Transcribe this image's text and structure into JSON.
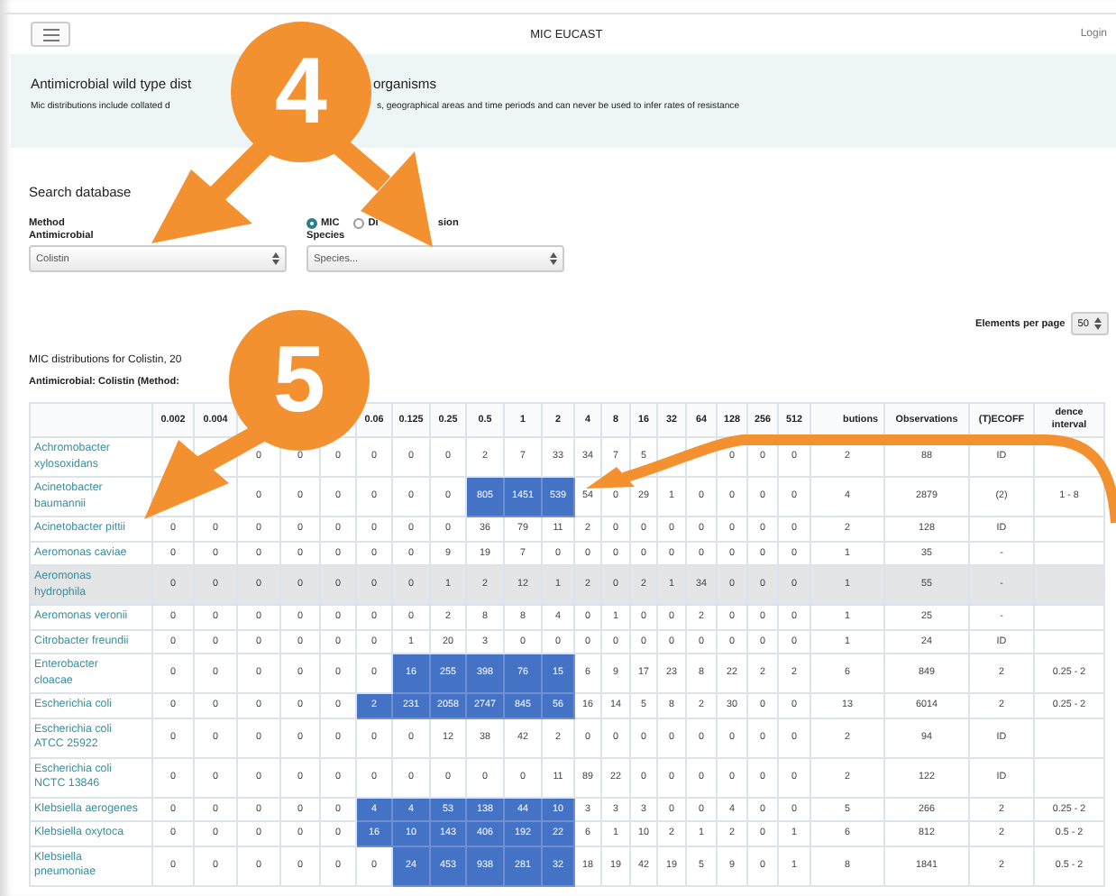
{
  "navbar": {
    "title": "MIC EUCAST",
    "login": "Login"
  },
  "banner": {
    "title_parts": [
      "Antimicrobial wild type dist",
      "organisms"
    ],
    "subtitle_parts": [
      "Mic distributions include collated d",
      "s, geographical areas and time periods and can never be used to infer rates of resistance"
    ]
  },
  "search": {
    "heading": "Search database",
    "method_label": "Method",
    "methods": [
      {
        "label_parts": [
          "MIC"
        ],
        "selected": true
      },
      {
        "label_parts": [
          "Di",
          "sion"
        ],
        "selected": false
      }
    ],
    "antimicrobial": {
      "label": "Antimicrobial",
      "value": "Colistin"
    },
    "species": {
      "label": "Species",
      "value": "Species..."
    }
  },
  "elements_per_page": {
    "label": "Elements per page",
    "value": "50"
  },
  "results": {
    "title": "MIC distributions for Colistin, 20",
    "subtitle": "Antimicrobial: Colistin (Method:"
  },
  "table": {
    "mic_columns": [
      {
        "label": "0.002"
      },
      {
        "label": "0.004"
      },
      {},
      {},
      {},
      {
        "label": "0.06"
      },
      {
        "label": "0.125"
      },
      {
        "label": "0.25"
      },
      {
        "label": "0.5"
      },
      {
        "label": "1"
      },
      {
        "label": "2"
      },
      {
        "label": "4"
      },
      {
        "label": "8"
      },
      {
        "label": "16"
      },
      {
        "label": "32"
      },
      {
        "label": "64"
      },
      {
        "label": "128"
      },
      {
        "label": "256"
      },
      {
        "label": "512"
      }
    ],
    "other_columns": [
      "butions",
      "Observations",
      "(T)ECOFF",
      "dence interval"
    ],
    "rows": [
      {
        "name": "Achromobacter xylosoxidans",
        "highlighted": false,
        "cells": [
          {
            "marked": false
          },
          {
            "marked": false
          },
          {
            "value": "0",
            "marked": false
          },
          {
            "value": "0",
            "marked": false
          },
          {
            "value": "0",
            "marked": false
          },
          {
            "value": "0",
            "marked": false
          },
          {
            "value": "0",
            "marked": false
          },
          {
            "value": "0",
            "marked": false
          },
          {
            "value": "2",
            "marked": false
          },
          {
            "value": "7",
            "marked": false
          },
          {
            "value": "33",
            "marked": false
          },
          {
            "value": "34",
            "marked": false
          },
          {
            "value": "7",
            "marked": false
          },
          {
            "value": "5",
            "marked": false
          },
          {
            "marked": false
          },
          {
            "marked": false
          },
          {
            "value": "0",
            "marked": false
          },
          {
            "value": "0",
            "marked": false
          },
          {
            "value": "0",
            "marked": false
          }
        ],
        "column_20": "2",
        "observations": "88",
        "ecoff": "ID"
      },
      {
        "name": "Acinetobacter baumannii",
        "highlighted": false,
        "cells": [
          {
            "marked": false
          },
          {
            "marked": false
          },
          {
            "value": "0",
            "marked": false
          },
          {
            "value": "0",
            "marked": false
          },
          {
            "value": "0",
            "marked": false
          },
          {
            "value": "0",
            "marked": false
          },
          {
            "value": "0",
            "marked": false
          },
          {
            "value": "0",
            "marked": false
          },
          {
            "value": "805",
            "marked": true
          },
          {
            "value": "1451",
            "marked": true
          },
          {
            "value": "539",
            "marked": true
          },
          {
            "value": "54",
            "marked": false
          },
          {
            "value": "0",
            "marked": false
          },
          {
            "value": "29",
            "marked": false
          },
          {
            "value": "1",
            "marked": false
          },
          {
            "value": "0",
            "marked": false
          },
          {
            "value": "0",
            "marked": false
          },
          {
            "value": "0",
            "marked": false
          },
          {
            "value": "0",
            "marked": false
          }
        ],
        "column_20": "4",
        "observations": "2879",
        "ecoff": "(2)",
        "column_23": "1 - 8"
      },
      {
        "name": "Acinetobacter pittii",
        "highlighted": false,
        "cells": [
          {
            "value": "0",
            "marked": false
          },
          {
            "value": "0",
            "marked": false
          },
          {
            "value": "0",
            "marked": false
          },
          {
            "value": "0",
            "marked": false
          },
          {
            "value": "0",
            "marked": false
          },
          {
            "value": "0",
            "marked": false
          },
          {
            "value": "0",
            "marked": false
          },
          {
            "value": "0",
            "marked": false
          },
          {
            "value": "36",
            "marked": false
          },
          {
            "value": "79",
            "marked": false
          },
          {
            "value": "11",
            "marked": false
          },
          {
            "value": "2",
            "marked": false
          },
          {
            "value": "0",
            "marked": false
          },
          {
            "value": "0",
            "marked": false
          },
          {
            "value": "0",
            "marked": false
          },
          {
            "value": "0",
            "marked": false
          },
          {
            "value": "0",
            "marked": false
          },
          {
            "value": "0",
            "marked": false
          },
          {
            "value": "0",
            "marked": false
          }
        ],
        "column_20": "2",
        "observations": "128",
        "ecoff": "ID"
      },
      {
        "name": "Aeromonas caviae",
        "highlighted": false,
        "cells": [
          {
            "value": "0",
            "marked": false
          },
          {
            "value": "0",
            "marked": false
          },
          {
            "value": "0",
            "marked": false
          },
          {
            "value": "0",
            "marked": false
          },
          {
            "value": "0",
            "marked": false
          },
          {
            "value": "0",
            "marked": false
          },
          {
            "value": "0",
            "marked": false
          },
          {
            "value": "9",
            "marked": false
          },
          {
            "value": "19",
            "marked": false
          },
          {
            "value": "7",
            "marked": false
          },
          {
            "value": "0",
            "marked": false
          },
          {
            "value": "0",
            "marked": false
          },
          {
            "value": "0",
            "marked": false
          },
          {
            "value": "0",
            "marked": false
          },
          {
            "value": "0",
            "marked": false
          },
          {
            "value": "0",
            "marked": false
          },
          {
            "value": "0",
            "marked": false
          },
          {
            "value": "0",
            "marked": false
          },
          {
            "value": "0",
            "marked": false
          }
        ],
        "column_20": "1",
        "observations": "35",
        "ecoff": "-"
      },
      {
        "name": "Aeromonas hydrophila",
        "highlighted": true,
        "cells": [
          {
            "value": "0",
            "marked": false
          },
          {
            "value": "0",
            "marked": false
          },
          {
            "value": "0",
            "marked": false
          },
          {
            "value": "0",
            "marked": false
          },
          {
            "value": "0",
            "marked": false
          },
          {
            "value": "0",
            "marked": false
          },
          {
            "value": "0",
            "marked": false
          },
          {
            "value": "1",
            "marked": false
          },
          {
            "value": "2",
            "marked": false
          },
          {
            "value": "12",
            "marked": false
          },
          {
            "value": "1",
            "marked": false
          },
          {
            "value": "2",
            "marked": false
          },
          {
            "value": "0",
            "marked": false
          },
          {
            "value": "2",
            "marked": false
          },
          {
            "value": "1",
            "marked": false
          },
          {
            "value": "34",
            "marked": false
          },
          {
            "value": "0",
            "marked": false
          },
          {
            "value": "0",
            "marked": false
          },
          {
            "value": "0",
            "marked": false
          }
        ],
        "column_20": "1",
        "observations": "55",
        "ecoff": "-"
      },
      {
        "name": "Aeromonas veronii",
        "highlighted": false,
        "cells": [
          {
            "value": "0",
            "marked": false
          },
          {
            "value": "0",
            "marked": false
          },
          {
            "value": "0",
            "marked": false
          },
          {
            "value": "0",
            "marked": false
          },
          {
            "value": "0",
            "marked": false
          },
          {
            "value": "0",
            "marked": false
          },
          {
            "value": "0",
            "marked": false
          },
          {
            "value": "2",
            "marked": false
          },
          {
            "value": "8",
            "marked": false
          },
          {
            "value": "8",
            "marked": false
          },
          {
            "value": "4",
            "marked": false
          },
          {
            "value": "0",
            "marked": false
          },
          {
            "value": "1",
            "marked": false
          },
          {
            "value": "0",
            "marked": false
          },
          {
            "value": "0",
            "marked": false
          },
          {
            "value": "2",
            "marked": false
          },
          {
            "value": "0",
            "marked": false
          },
          {
            "value": "0",
            "marked": false
          },
          {
            "value": "0",
            "marked": false
          }
        ],
        "column_20": "1",
        "observations": "25",
        "ecoff": "-"
      },
      {
        "name": "Citrobacter freundii",
        "highlighted": false,
        "cells": [
          {
            "value": "0",
            "marked": false
          },
          {
            "value": "0",
            "marked": false
          },
          {
            "value": "0",
            "marked": false
          },
          {
            "value": "0",
            "marked": false
          },
          {
            "value": "0",
            "marked": false
          },
          {
            "value": "0",
            "marked": false
          },
          {
            "value": "1",
            "marked": false
          },
          {
            "value": "20",
            "marked": false
          },
          {
            "value": "3",
            "marked": false
          },
          {
            "value": "0",
            "marked": false
          },
          {
            "value": "0",
            "marked": false
          },
          {
            "value": "0",
            "marked": false
          },
          {
            "value": "0",
            "marked": false
          },
          {
            "value": "0",
            "marked": false
          },
          {
            "value": "0",
            "marked": false
          },
          {
            "value": "0",
            "marked": false
          },
          {
            "value": "0",
            "marked": false
          },
          {
            "value": "0",
            "marked": false
          },
          {
            "value": "0",
            "marked": false
          }
        ],
        "column_20": "1",
        "observations": "24",
        "ecoff": "ID"
      },
      {
        "name": "Enterobacter cloacae",
        "highlighted": false,
        "cells": [
          {
            "value": "0",
            "marked": false
          },
          {
            "value": "0",
            "marked": false
          },
          {
            "value": "0",
            "marked": false
          },
          {
            "value": "0",
            "marked": false
          },
          {
            "value": "0",
            "marked": false
          },
          {
            "value": "0",
            "marked": false
          },
          {
            "value": "16",
            "marked": true
          },
          {
            "value": "255",
            "marked": true
          },
          {
            "value": "398",
            "marked": true
          },
          {
            "value": "76",
            "marked": true
          },
          {
            "value": "15",
            "marked": true
          },
          {
            "value": "6",
            "marked": false
          },
          {
            "value": "9",
            "marked": false
          },
          {
            "value": "17",
            "marked": false
          },
          {
            "value": "23",
            "marked": false
          },
          {
            "value": "8",
            "marked": false
          },
          {
            "value": "22",
            "marked": false
          },
          {
            "value": "2",
            "marked": false
          },
          {
            "value": "2",
            "marked": false
          }
        ],
        "column_20": "6",
        "observations": "849",
        "ecoff": "2",
        "column_23": "0.25 - 2"
      },
      {
        "name": "Escherichia coli",
        "highlighted": false,
        "cells": [
          {
            "value": "0",
            "marked": false
          },
          {
            "value": "0",
            "marked": false
          },
          {
            "value": "0",
            "marked": false
          },
          {
            "value": "0",
            "marked": false
          },
          {
            "value": "0",
            "marked": false
          },
          {
            "value": "2",
            "marked": true
          },
          {
            "value": "231",
            "marked": true
          },
          {
            "value": "2058",
            "marked": true
          },
          {
            "value": "2747",
            "marked": true
          },
          {
            "value": "845",
            "marked": true
          },
          {
            "value": "56",
            "marked": true
          },
          {
            "value": "16",
            "marked": false
          },
          {
            "value": "14",
            "marked": false
          },
          {
            "value": "5",
            "marked": false
          },
          {
            "value": "8",
            "marked": false
          },
          {
            "value": "2",
            "marked": false
          },
          {
            "value": "30",
            "marked": false
          },
          {
            "value": "0",
            "marked": false
          },
          {
            "value": "0",
            "marked": false
          }
        ],
        "column_20": "13",
        "observations": "6014",
        "ecoff": "2",
        "column_23": "0.25 - 2"
      },
      {
        "name": "Escherichia coli ATCC 25922",
        "highlighted": false,
        "cells": [
          {
            "value": "0",
            "marked": false
          },
          {
            "value": "0",
            "marked": false
          },
          {
            "value": "0",
            "marked": false
          },
          {
            "value": "0",
            "marked": false
          },
          {
            "value": "0",
            "marked": false
          },
          {
            "value": "0",
            "marked": false
          },
          {
            "value": "0",
            "marked": false
          },
          {
            "value": "12",
            "marked": false
          },
          {
            "value": "38",
            "marked": false
          },
          {
            "value": "42",
            "marked": false
          },
          {
            "value": "2",
            "marked": false
          },
          {
            "value": "0",
            "marked": false
          },
          {
            "value": "0",
            "marked": false
          },
          {
            "value": "0",
            "marked": false
          },
          {
            "value": "0",
            "marked": false
          },
          {
            "value": "0",
            "marked": false
          },
          {
            "value": "0",
            "marked": false
          },
          {
            "value": "0",
            "marked": false
          },
          {
            "value": "0",
            "marked": false
          }
        ],
        "column_20": "2",
        "observations": "94",
        "ecoff": "ID"
      },
      {
        "name": "Escherichia coli NCTC 13846",
        "highlighted": false,
        "cells": [
          {
            "value": "0",
            "marked": false
          },
          {
            "value": "0",
            "marked": false
          },
          {
            "value": "0",
            "marked": false
          },
          {
            "value": "0",
            "marked": false
          },
          {
            "value": "0",
            "marked": false
          },
          {
            "value": "0",
            "marked": false
          },
          {
            "value": "0",
            "marked": false
          },
          {
            "value": "0",
            "marked": false
          },
          {
            "value": "0",
            "marked": false
          },
          {
            "value": "0",
            "marked": false
          },
          {
            "value": "11",
            "marked": false
          },
          {
            "value": "89",
            "marked": false
          },
          {
            "value": "22",
            "marked": false
          },
          {
            "value": "0",
            "marked": false
          },
          {
            "value": "0",
            "marked": false
          },
          {
            "value": "0",
            "marked": false
          },
          {
            "value": "0",
            "marked": false
          },
          {
            "value": "0",
            "marked": false
          },
          {
            "value": "0",
            "marked": false
          }
        ],
        "column_20": "2",
        "observations": "122",
        "ecoff": "ID"
      },
      {
        "name": "Klebsiella aerogenes",
        "highlighted": false,
        "cells": [
          {
            "value": "0",
            "marked": false
          },
          {
            "value": "0",
            "marked": false
          },
          {
            "value": "0",
            "marked": false
          },
          {
            "value": "0",
            "marked": false
          },
          {
            "value": "0",
            "marked": false
          },
          {
            "value": "4",
            "marked": true
          },
          {
            "value": "4",
            "marked": true
          },
          {
            "value": "53",
            "marked": true
          },
          {
            "value": "138",
            "marked": true
          },
          {
            "value": "44",
            "marked": true
          },
          {
            "value": "10",
            "marked": true
          },
          {
            "value": "3",
            "marked": false
          },
          {
            "value": "3",
            "marked": false
          },
          {
            "value": "3",
            "marked": false
          },
          {
            "value": "0",
            "marked": false
          },
          {
            "value": "0",
            "marked": false
          },
          {
            "value": "4",
            "marked": false
          },
          {
            "value": "0",
            "marked": false
          },
          {
            "value": "0",
            "marked": false
          }
        ],
        "column_20": "5",
        "observations": "266",
        "ecoff": "2",
        "column_23": "0.25 - 2"
      },
      {
        "name": "Klebsiella oxytoca",
        "highlighted": false,
        "cells": [
          {
            "value": "0",
            "marked": false
          },
          {
            "value": "0",
            "marked": false
          },
          {
            "value": "0",
            "marked": false
          },
          {
            "value": "0",
            "marked": false
          },
          {
            "value": "0",
            "marked": false
          },
          {
            "value": "16",
            "marked": true
          },
          {
            "value": "10",
            "marked": true
          },
          {
            "value": "143",
            "marked": true
          },
          {
            "value": "406",
            "marked": true
          },
          {
            "value": "192",
            "marked": true
          },
          {
            "value": "22",
            "marked": true
          },
          {
            "value": "6",
            "marked": false
          },
          {
            "value": "1",
            "marked": false
          },
          {
            "value": "10",
            "marked": false
          },
          {
            "value": "2",
            "marked": false
          },
          {
            "value": "1",
            "marked": false
          },
          {
            "value": "2",
            "marked": false
          },
          {
            "value": "0",
            "marked": false
          },
          {
            "value": "1",
            "marked": false
          }
        ],
        "column_20": "6",
        "observations": "812",
        "ecoff": "2",
        "column_23": "0.5 - 2"
      },
      {
        "name": "Klebsiella pneumoniae",
        "highlighted": false,
        "cells": [
          {
            "value": "0",
            "marked": false
          },
          {
            "value": "0",
            "marked": false
          },
          {
            "value": "0",
            "marked": false
          },
          {
            "value": "0",
            "marked": false
          },
          {
            "value": "0",
            "marked": false
          },
          {
            "value": "0",
            "marked": false
          },
          {
            "value": "24",
            "marked": true
          },
          {
            "value": "453",
            "marked": true
          },
          {
            "value": "938",
            "marked": true
          },
          {
            "value": "281",
            "marked": true
          },
          {
            "value": "32",
            "marked": true
          },
          {
            "value": "18",
            "marked": false
          },
          {
            "value": "19",
            "marked": false
          },
          {
            "value": "42",
            "marked": false
          },
          {
            "value": "19",
            "marked": false
          },
          {
            "value": "5",
            "marked": false
          },
          {
            "value": "9",
            "marked": false
          },
          {
            "value": "0",
            "marked": false
          },
          {
            "value": "1",
            "marked": false
          }
        ],
        "column_20": "8",
        "observations": "1841",
        "ecoff": "2",
        "column_23": "0.5 - 2"
      }
    ]
  },
  "callouts": [
    {
      "number": "4"
    },
    {
      "number": "5"
    }
  ]
}
